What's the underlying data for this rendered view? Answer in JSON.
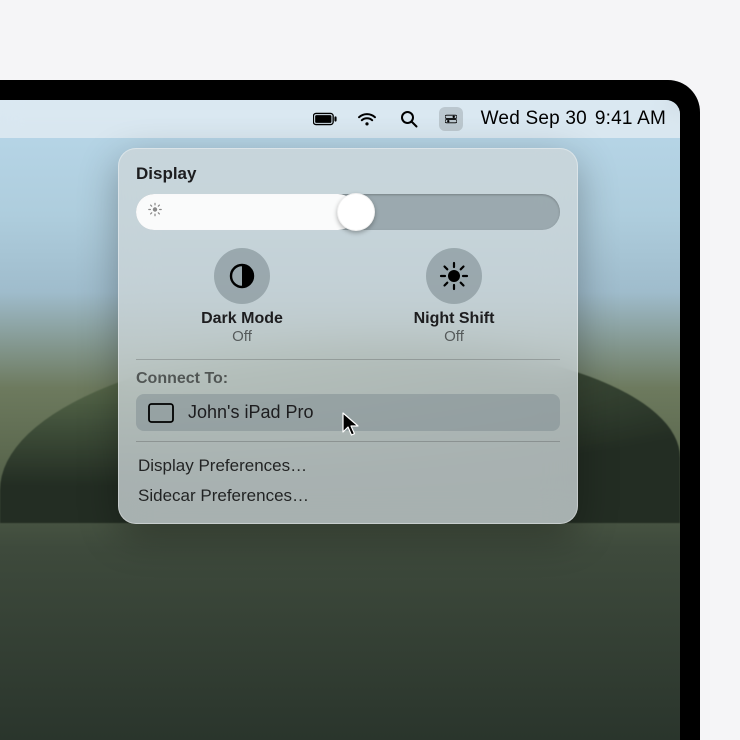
{
  "menubar": {
    "date": "Wed Sep 30",
    "time": "9:41 AM"
  },
  "panel": {
    "title": "Display",
    "brightness_percent": 52,
    "toggles": {
      "dark_mode": {
        "label": "Dark Mode",
        "status": "Off"
      },
      "night_shift": {
        "label": "Night Shift",
        "status": "Off"
      }
    },
    "connect_label": "Connect To:",
    "device": "John's iPad Pro",
    "links": {
      "display_prefs": "Display Preferences…",
      "sidecar_prefs": "Sidecar Preferences…"
    }
  }
}
